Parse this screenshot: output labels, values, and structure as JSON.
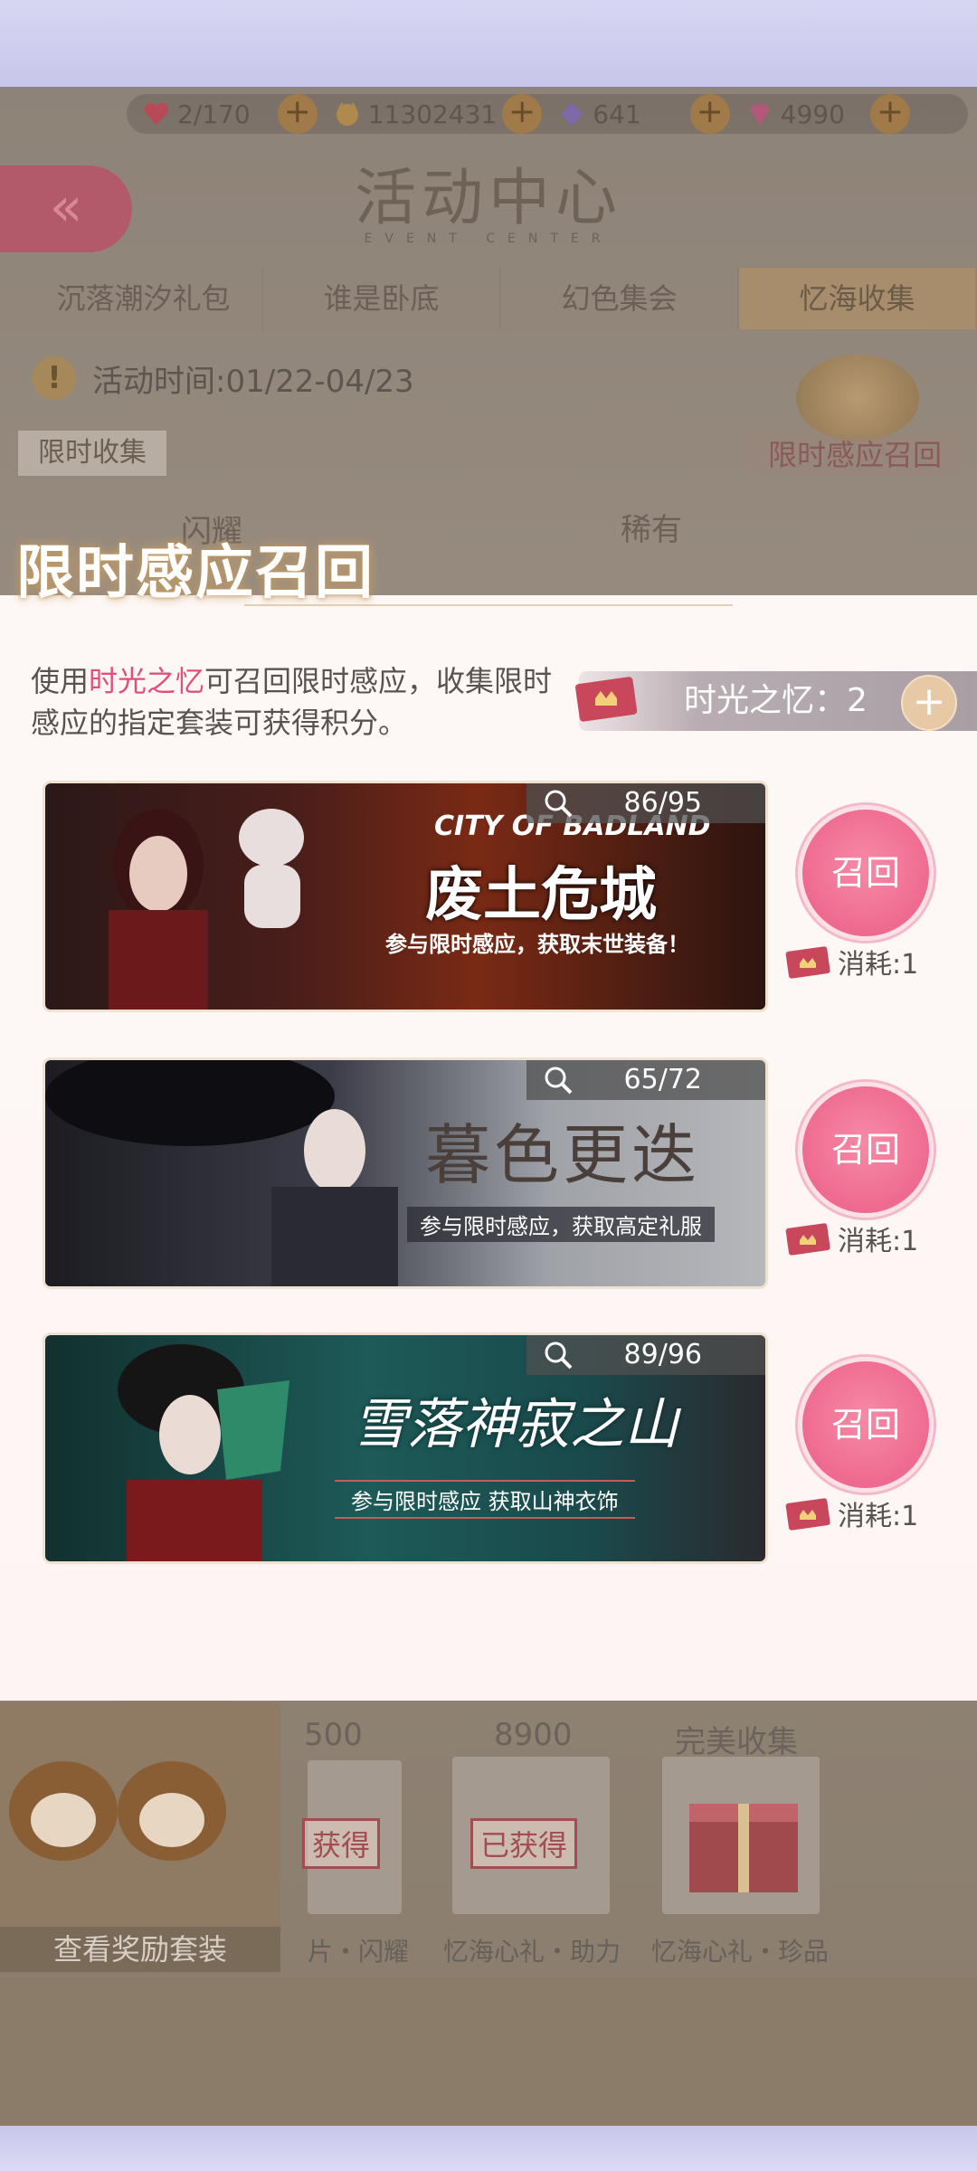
{
  "resources": [
    {
      "icon": "heart-icon",
      "value": "2/170"
    },
    {
      "icon": "cat-coin-icon",
      "value": "11302431"
    },
    {
      "icon": "crystal-icon",
      "value": "641"
    },
    {
      "icon": "diamond-icon",
      "value": "4990"
    }
  ],
  "header": {
    "title": "活动中心",
    "subtitle": "EVENT CENTER"
  },
  "tabs": [
    "沉落潮汐礼包",
    "谁是卧底",
    "幻色集会",
    "忆海收集"
  ],
  "event_time": "活动时间:01/22-04/23",
  "limited_tag": "限时收集",
  "recall_tag": "限时感应召回",
  "rarity_labels": [
    "闪耀",
    "稀有"
  ],
  "popup": {
    "title": "限时感应召回",
    "desc_prefix": "使用",
    "desc_highlight": "时光之忆",
    "desc_rest": "可召回限时感应，收集限时感应的指定套装可获得积分。",
    "currency_label": "时光之忆：2",
    "banners": [
      {
        "counter": "86/95",
        "title_cn": "废土危城",
        "title_en": "CITY OF BADLAND",
        "subtitle": "参与限时感应，获取末世装备！",
        "recall": "召回",
        "cost": "消耗:1"
      },
      {
        "counter": "65/72",
        "title_cn": "暮色更迭",
        "subtitle": "参与限时感应，获取高定礼服",
        "recall": "召回",
        "cost": "消耗:1"
      },
      {
        "counter": "89/96",
        "title_cn": "雪落神寂之山",
        "subtitle": "参与限时感应 获取山神衣饰",
        "recall": "召回",
        "cost": "消耗:1"
      }
    ]
  },
  "bottom": {
    "view_suit": "查看奖励套装",
    "milestones": [
      "500",
      "8900",
      "完美收集"
    ],
    "stamps": [
      "获得",
      "已获得"
    ],
    "reward_names": [
      "片・闪耀",
      "忆海心礼・助力",
      "忆海心礼・珍品"
    ]
  },
  "colors": {
    "accent_pink": "#ee6a8e",
    "highlight": "#e0507a",
    "tab_active": "#a78d6c"
  }
}
